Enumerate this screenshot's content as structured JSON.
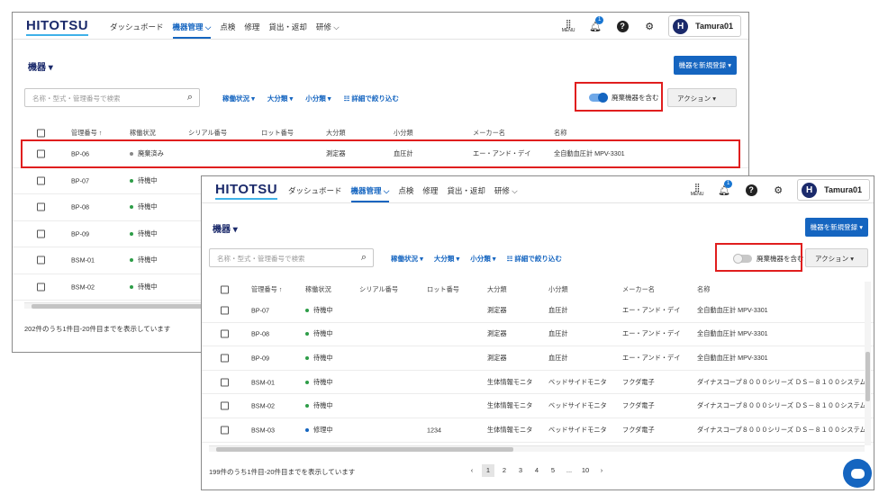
{
  "header": {
    "logo": "HITOTSU",
    "nav": [
      {
        "label": "ダッシュボード"
      },
      {
        "label": "機器管理 ⌵"
      },
      {
        "label": "点検"
      },
      {
        "label": "修理"
      },
      {
        "label": "貸出・返却"
      },
      {
        "label": "研修 ⌵"
      }
    ],
    "menu_label": "MENU",
    "notification_count": "1",
    "help_icon": "?",
    "settings_icon": "⚙",
    "user_initial": "H",
    "user_name": "Tamura01"
  },
  "page": {
    "title": "機器 ▾",
    "new_button": "機器を新規登録 ▾",
    "search_placeholder": "名称・型式・管理番号で検索",
    "filters": [
      "稼働状況 ▾",
      "大分類 ▾",
      "小分類 ▾",
      "☷ 詳細で絞り込む"
    ],
    "toggle_label": "廃棄機器を含む",
    "action_button": "アクション ▾"
  },
  "columns": [
    "管理番号 ↑",
    "稼働状況",
    "シリアル番号",
    "ロット番号",
    "大分類",
    "小分類",
    "メーカー名",
    "名称"
  ],
  "window1": {
    "toggle_on": true,
    "rows": [
      {
        "id": "BP-06",
        "status": "廃棄済み",
        "status_color": "#888888",
        "serial": "",
        "lot": "",
        "major": "測定器",
        "minor": "血圧計",
        "maker": "エー・アンド・デイ",
        "name": "全自動血圧計 MPV-3301"
      },
      {
        "id": "BP-07",
        "status": "待機中",
        "status_color": "#2e9d48"
      },
      {
        "id": "BP-08",
        "status": "待機中",
        "status_color": "#2e9d48"
      },
      {
        "id": "BP-09",
        "status": "待機中",
        "status_color": "#2e9d48"
      },
      {
        "id": "BSM-01",
        "status": "待機中",
        "status_color": "#2e9d48"
      },
      {
        "id": "BSM-02",
        "status": "待機中",
        "status_color": "#2e9d48"
      }
    ],
    "footer": "202件のうち1件目-20件目までを表示しています"
  },
  "window2": {
    "toggle_on": false,
    "rows": [
      {
        "id": "BP-07",
        "status": "待機中",
        "status_color": "#2e9d48",
        "serial": "",
        "lot": "",
        "major": "測定器",
        "minor": "血圧計",
        "maker": "エー・アンド・デイ",
        "name": "全自動血圧計 MPV-3301"
      },
      {
        "id": "BP-08",
        "status": "待機中",
        "status_color": "#2e9d48",
        "serial": "",
        "lot": "",
        "major": "測定器",
        "minor": "血圧計",
        "maker": "エー・アンド・デイ",
        "name": "全自動血圧計 MPV-3301"
      },
      {
        "id": "BP-09",
        "status": "待機中",
        "status_color": "#2e9d48",
        "serial": "",
        "lot": "",
        "major": "測定器",
        "minor": "血圧計",
        "maker": "エー・アンド・デイ",
        "name": "全自動血圧計 MPV-3301"
      },
      {
        "id": "BSM-01",
        "status": "待機中",
        "status_color": "#2e9d48",
        "serial": "",
        "lot": "",
        "major": "生体情報モニタ",
        "minor": "ベッドサイドモニタ",
        "maker": "フクダ電子",
        "name": "ダイナスコープ８０００シリーズ ＤＳ－８１００システム"
      },
      {
        "id": "BSM-02",
        "status": "待機中",
        "status_color": "#2e9d48",
        "serial": "",
        "lot": "",
        "major": "生体情報モニタ",
        "minor": "ベッドサイドモニタ",
        "maker": "フクダ電子",
        "name": "ダイナスコープ８０００シリーズ ＤＳ－８１００システム"
      },
      {
        "id": "BSM-03",
        "status": "修理中",
        "status_color": "#1565c0",
        "serial": "",
        "lot": "1234",
        "major": "生体情報モニタ",
        "minor": "ベッドサイドモニタ",
        "maker": "フクダ電子",
        "name": "ダイナスコープ８０００シリーズ ＤＳ－８１００システム"
      }
    ],
    "footer": "199件のうち1件目-20件目までを表示しています",
    "pagination": [
      "‹",
      "1",
      "2",
      "3",
      "4",
      "5",
      "...",
      "10",
      "›"
    ],
    "current_page": "1"
  },
  "colors": {
    "accent": "#1565c0",
    "highlight": "#e01e1e",
    "brand": "#1b2a6b"
  }
}
